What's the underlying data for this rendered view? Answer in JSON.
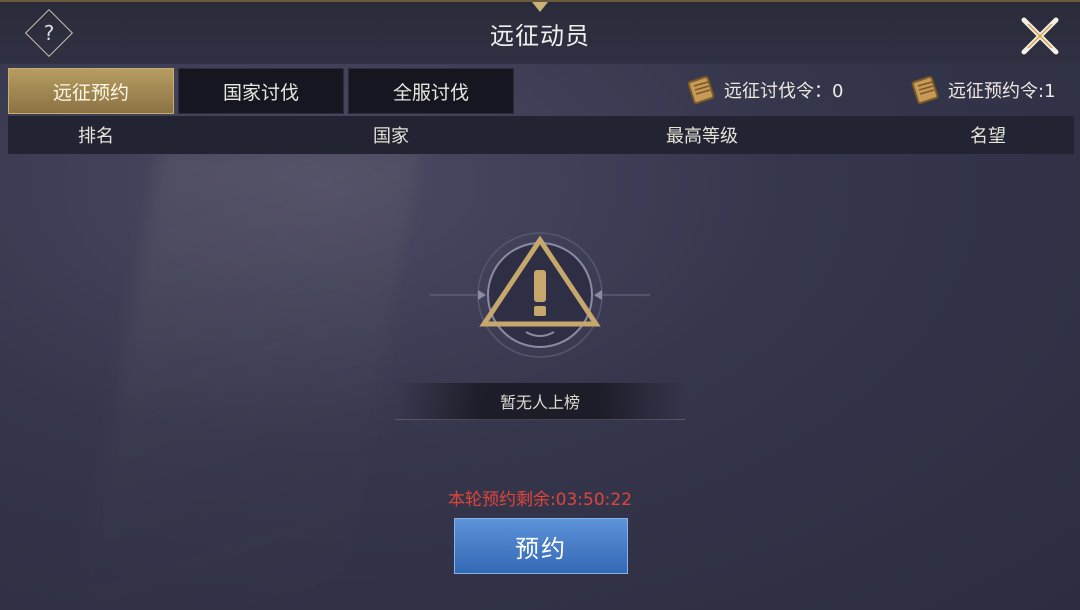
{
  "window": {
    "title": "远征动员",
    "help_symbol": "?"
  },
  "tabs": [
    {
      "label": "远征预约",
      "active": true
    },
    {
      "label": "国家讨伐",
      "active": false
    },
    {
      "label": "全服讨伐",
      "active": false
    }
  ],
  "tokens": [
    {
      "icon": "scroll-icon",
      "label": "远征讨伐令：0"
    },
    {
      "icon": "scroll-icon",
      "label": "远征预约令:1"
    }
  ],
  "table": {
    "columns": [
      "排名",
      "国家",
      "最高等级",
      "名望"
    ]
  },
  "empty_state": {
    "icon": "warning-icon",
    "message": "暂无人上榜"
  },
  "countdown": "本轮预约剩余:03:50:22",
  "reserve_button": "预约",
  "colors": {
    "accent_gold": "#b79d63",
    "button_blue": "#4a7fc6",
    "countdown_red": "#e0453a"
  }
}
